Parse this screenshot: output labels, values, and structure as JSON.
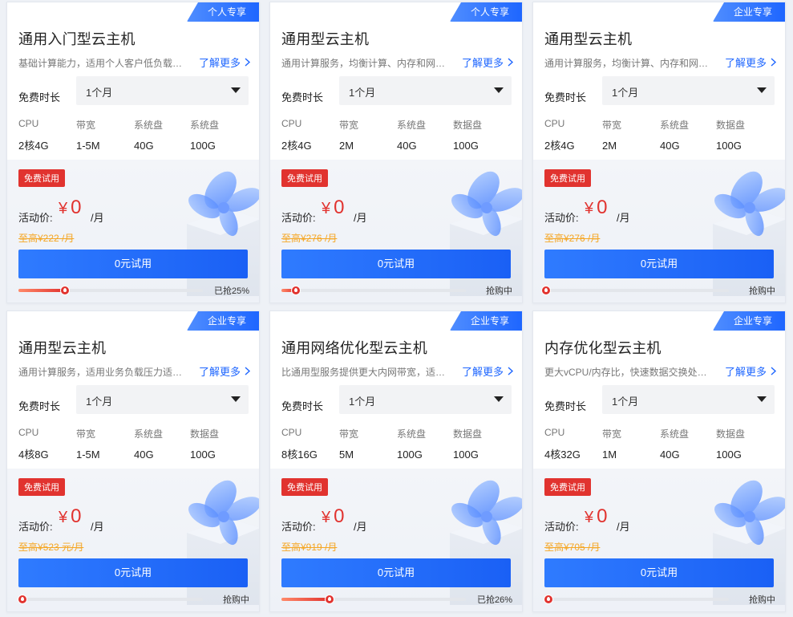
{
  "cards": [
    {
      "tag": "个人专享",
      "title": "通用入门型云主机",
      "desc": "基础计算能力，适用个人客户低负载应用场景",
      "more": "了解更多",
      "duration_label": "免费时长",
      "duration_value": "1个月",
      "specs": [
        {
          "label": "CPU",
          "value": "2核4G"
        },
        {
          "label": "带宽",
          "value": "1-5M"
        },
        {
          "label": "系统盘",
          "value": "40G"
        },
        {
          "label": "系统盘",
          "value": "100G"
        }
      ],
      "badge": "免费试用",
      "price_label": "活动价:",
      "currency": "¥",
      "price": "0",
      "unit": "/月",
      "original": "至高¥222 /月",
      "button": "0元试用",
      "progress": 0.25,
      "status": "已抢25%"
    },
    {
      "tag": "个人专享",
      "title": "通用型云主机",
      "desc": "通用计算服务，均衡计算、内存和网络资源",
      "more": "了解更多",
      "duration_label": "免费时长",
      "duration_value": "1个月",
      "specs": [
        {
          "label": "CPU",
          "value": "2核4G"
        },
        {
          "label": "带宽",
          "value": "2M"
        },
        {
          "label": "系统盘",
          "value": "40G"
        },
        {
          "label": "数据盘",
          "value": "100G"
        }
      ],
      "badge": "免费试用",
      "price_label": "活动价:",
      "currency": "¥",
      "price": "0",
      "unit": "/月",
      "original": "至高¥276 /月",
      "button": "0元试用",
      "progress": 0.08,
      "status": "抢购中"
    },
    {
      "tag": "企业专享",
      "title": "通用型云主机",
      "desc": "通用计算服务，均衡计算、内存和网络资源",
      "more": "了解更多",
      "duration_label": "免费时长",
      "duration_value": "1个月",
      "specs": [
        {
          "label": "CPU",
          "value": "2核4G"
        },
        {
          "label": "带宽",
          "value": "2M"
        },
        {
          "label": "系统盘",
          "value": "40G"
        },
        {
          "label": "数据盘",
          "value": "100G"
        }
      ],
      "badge": "免费试用",
      "price_label": "活动价:",
      "currency": "¥",
      "price": "0",
      "unit": "/月",
      "original": "至高¥276 /月",
      "button": "0元试用",
      "progress": 0.0,
      "status": "抢购中"
    },
    {
      "tag": "企业专享",
      "title": "通用型云主机",
      "desc": "通用计算服务，适用业务负载压力适中的场景",
      "more": "了解更多",
      "duration_label": "免费时长",
      "duration_value": "1个月",
      "specs": [
        {
          "label": "CPU",
          "value": "4核8G"
        },
        {
          "label": "带宽",
          "value": "1-5M"
        },
        {
          "label": "系统盘",
          "value": "40G"
        },
        {
          "label": "数据盘",
          "value": "100G"
        }
      ],
      "badge": "免费试用",
      "price_label": "活动价:",
      "currency": "¥",
      "price": "0",
      "unit": "/月",
      "original": "至高¥523 元/月",
      "button": "0元试用",
      "progress": 0.02,
      "status": "抢购中"
    },
    {
      "tag": "企业专享",
      "title": "通用网络优化型云主机",
      "desc": "比通用型服务提供更大内网带宽，适合高网络包收发场景",
      "more": "了解更多",
      "duration_label": "免费时长",
      "duration_value": "1个月",
      "specs": [
        {
          "label": "CPU",
          "value": "8核16G"
        },
        {
          "label": "带宽",
          "value": "5M"
        },
        {
          "label": "系统盘",
          "value": "100G"
        },
        {
          "label": "数据盘",
          "value": "100G"
        }
      ],
      "badge": "免费试用",
      "price_label": "活动价:",
      "currency": "¥",
      "price": "0",
      "unit": "/月",
      "original": "至高¥919 /月",
      "button": "0元试用",
      "progress": 0.26,
      "status": "已抢26%"
    },
    {
      "tag": "企业专享",
      "title": "内存优化型云主机",
      "desc": "更大vCPU/内存比，快速数据交换处理能力",
      "more": "了解更多",
      "duration_label": "免费时长",
      "duration_value": "1个月",
      "specs": [
        {
          "label": "CPU",
          "value": "4核32G"
        },
        {
          "label": "带宽",
          "value": "1M"
        },
        {
          "label": "系统盘",
          "value": "40G"
        },
        {
          "label": "数据盘",
          "value": "100G"
        }
      ],
      "badge": "免费试用",
      "price_label": "活动价:",
      "currency": "¥",
      "price": "0",
      "unit": "/月",
      "original": "至高¥705 /月",
      "button": "0元试用",
      "progress": 0.02,
      "status": "抢购中"
    }
  ]
}
